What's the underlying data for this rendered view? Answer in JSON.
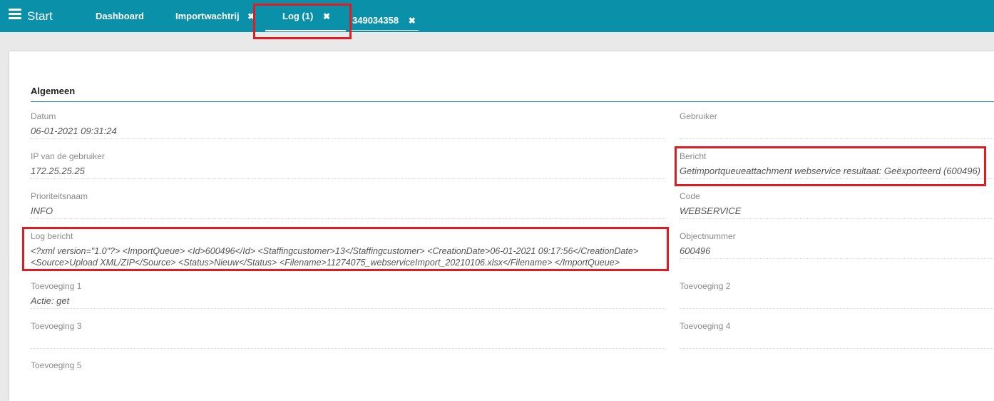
{
  "topbar": {
    "start_label": "Start",
    "tabs": [
      {
        "label": "Dashboard",
        "closable": false
      },
      {
        "label": "Importwachtrij",
        "closable": true
      },
      {
        "label": "Log (1)",
        "closable": true,
        "active": true
      },
      {
        "label": "349034358",
        "closable": true
      }
    ],
    "close_glyph": "✖"
  },
  "section": {
    "title": "Algemeen"
  },
  "fields": {
    "datum": {
      "label": "Datum",
      "value": "06-01-2021 09:31:24"
    },
    "gebruiker": {
      "label": "Gebruiker",
      "value": ""
    },
    "ip": {
      "label": "IP van de gebruiker",
      "value": "172.25.25.25"
    },
    "bericht": {
      "label": "Bericht",
      "value": "Getimportqueueattachment webservice resultaat: Geëxporteerd (600496)"
    },
    "prioriteit": {
      "label": "Prioriteitsnaam",
      "value": "INFO"
    },
    "code": {
      "label": "Code",
      "value": "WEBSERVICE"
    },
    "log_bericht": {
      "label": "Log bericht",
      "line1": "<?xml version=\"1.0\"?> <ImportQueue> <Id>600496</Id> <Staffingcustomer>13</Staffingcustomer> <CreationDate>06-01-2021 09:17:56</CreationDate>",
      "line2": "<Source>Upload XML/ZIP</Source> <Status>Nieuw</Status> <Filename>11274075_webserviceImport_20210106.xlsx</Filename> </ImportQueue>"
    },
    "objectnummer": {
      "label": "Objectnummer",
      "value": "600496"
    },
    "toevoeging1": {
      "label": "Toevoeging 1",
      "value": "Actie: get"
    },
    "toevoeging2": {
      "label": "Toevoeging 2",
      "value": ""
    },
    "toevoeging3": {
      "label": "Toevoeging 3",
      "value": ""
    },
    "toevoeging4": {
      "label": "Toevoeging 4",
      "value": ""
    },
    "toevoeging5": {
      "label": "Toevoeging 5",
      "value": ""
    }
  },
  "colors": {
    "topbar": "#0b90aa",
    "highlight": "#e01b22",
    "section_line": "#1a8aa5"
  }
}
